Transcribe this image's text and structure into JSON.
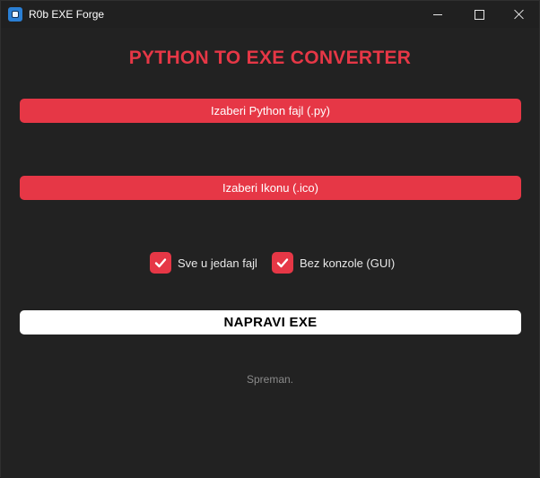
{
  "window": {
    "title": "R0b EXE Forge"
  },
  "main": {
    "heading": "PYTHON TO EXE CONVERTER",
    "choose_python_label": "Izaberi Python fajl (.py)",
    "choose_icon_label": "Izaberi Ikonu (.ico)",
    "options": [
      {
        "label": "Sve u jedan fajl",
        "checked": true
      },
      {
        "label": "Bez konzole (GUI)",
        "checked": true
      }
    ],
    "build_label": "NAPRAVI EXE",
    "status": "Spreman."
  },
  "colors": {
    "accent": "#e63746",
    "background": "#222222",
    "status_text": "#8a8a8a"
  },
  "icons": {
    "app": "app-icon",
    "minimize": "minimize-icon",
    "maximize": "maximize-icon",
    "close": "close-icon",
    "check": "checkmark-icon"
  }
}
